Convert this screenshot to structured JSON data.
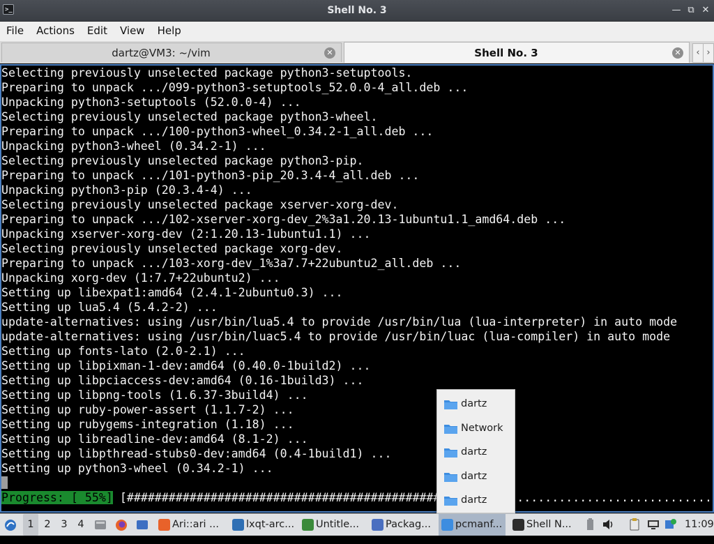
{
  "window": {
    "title": "Shell No. 3",
    "app_icon_text": ">_",
    "controls": {
      "minimize": "—",
      "maximize": "⧉",
      "close": "✕"
    }
  },
  "menu": [
    "File",
    "Actions",
    "Edit",
    "View",
    "Help"
  ],
  "tabs": [
    {
      "label": "dartz@VM3: ~/vim",
      "active": false
    },
    {
      "label": "Shell No. 3",
      "active": true
    }
  ],
  "tab_scroll": {
    "left": "‹",
    "right": "›"
  },
  "terminal": {
    "lines": [
      "Selecting previously unselected package python3-setuptools.",
      "Preparing to unpack .../099-python3-setuptools_52.0.0-4_all.deb ...",
      "Unpacking python3-setuptools (52.0.0-4) ...",
      "Selecting previously unselected package python3-wheel.",
      "Preparing to unpack .../100-python3-wheel_0.34.2-1_all.deb ...",
      "Unpacking python3-wheel (0.34.2-1) ...",
      "Selecting previously unselected package python3-pip.",
      "Preparing to unpack .../101-python3-pip_20.3.4-4_all.deb ...",
      "Unpacking python3-pip (20.3.4-4) ...",
      "Selecting previously unselected package xserver-xorg-dev.",
      "Preparing to unpack .../102-xserver-xorg-dev_2%3a1.20.13-1ubuntu1.1_amd64.deb ...",
      "Unpacking xserver-xorg-dev (2:1.20.13-1ubuntu1.1) ...",
      "Selecting previously unselected package xorg-dev.",
      "Preparing to unpack .../103-xorg-dev_1%3a7.7+22ubuntu2_all.deb ...",
      "Unpacking xorg-dev (1:7.7+22ubuntu2) ...",
      "Setting up libexpat1:amd64 (2.4.1-2ubuntu0.3) ...",
      "Setting up lua5.4 (5.4.2-2) ...",
      "update-alternatives: using /usr/bin/lua5.4 to provide /usr/bin/lua (lua-interpreter) in auto mode",
      "update-alternatives: using /usr/bin/luac5.4 to provide /usr/bin/luac (lua-compiler) in auto mode",
      "Setting up fonts-lato (2.0-2.1) ...",
      "Setting up libpixman-1-dev:amd64 (0.40.0-1build2) ...",
      "Setting up libpciaccess-dev:amd64 (0.16-1build3) ...",
      "Setting up libpng-tools (1.6.37-3build4) ...",
      "Setting up ruby-power-assert (1.1.7-2) ...",
      "Setting up rubygems-integration (1.18) ...",
      "Setting up libreadline-dev:amd64 (8.1-2) ...",
      "Setting up libpthread-stubs0-dev:amd64 (0.4-1build1) ...",
      "Setting up python3-wheel (0.34.2-1) ..."
    ],
    "progress": {
      "label": "Progress: [ 55%]",
      "percent": 55,
      "bar": "[#############################################.......................................]"
    }
  },
  "popup": {
    "items": [
      "dartz",
      "Network",
      "dartz",
      "dartz",
      "dartz"
    ]
  },
  "taskbar": {
    "desktops": [
      "1",
      "2",
      "3",
      "4"
    ],
    "active_desktop": "1",
    "tasks": [
      {
        "label": "Ari::ari ...",
        "icon": "firefox-icon",
        "color": "#e8622a"
      },
      {
        "label": "lxqt-arc...",
        "icon": "archive-icon",
        "color": "#2f6fb4"
      },
      {
        "label": "Untitle...",
        "icon": "document-icon",
        "color": "#3a8a3a"
      },
      {
        "label": "Packag...",
        "icon": "package-icon",
        "color": "#4a6fc0"
      },
      {
        "label": "pcmanf...",
        "icon": "folder-icon",
        "color": "#3d8de0"
      },
      {
        "label": "Shell N...",
        "icon": "terminal-icon",
        "color": "#2d2d2d"
      }
    ],
    "active_task": 4,
    "clock": "11:09"
  }
}
